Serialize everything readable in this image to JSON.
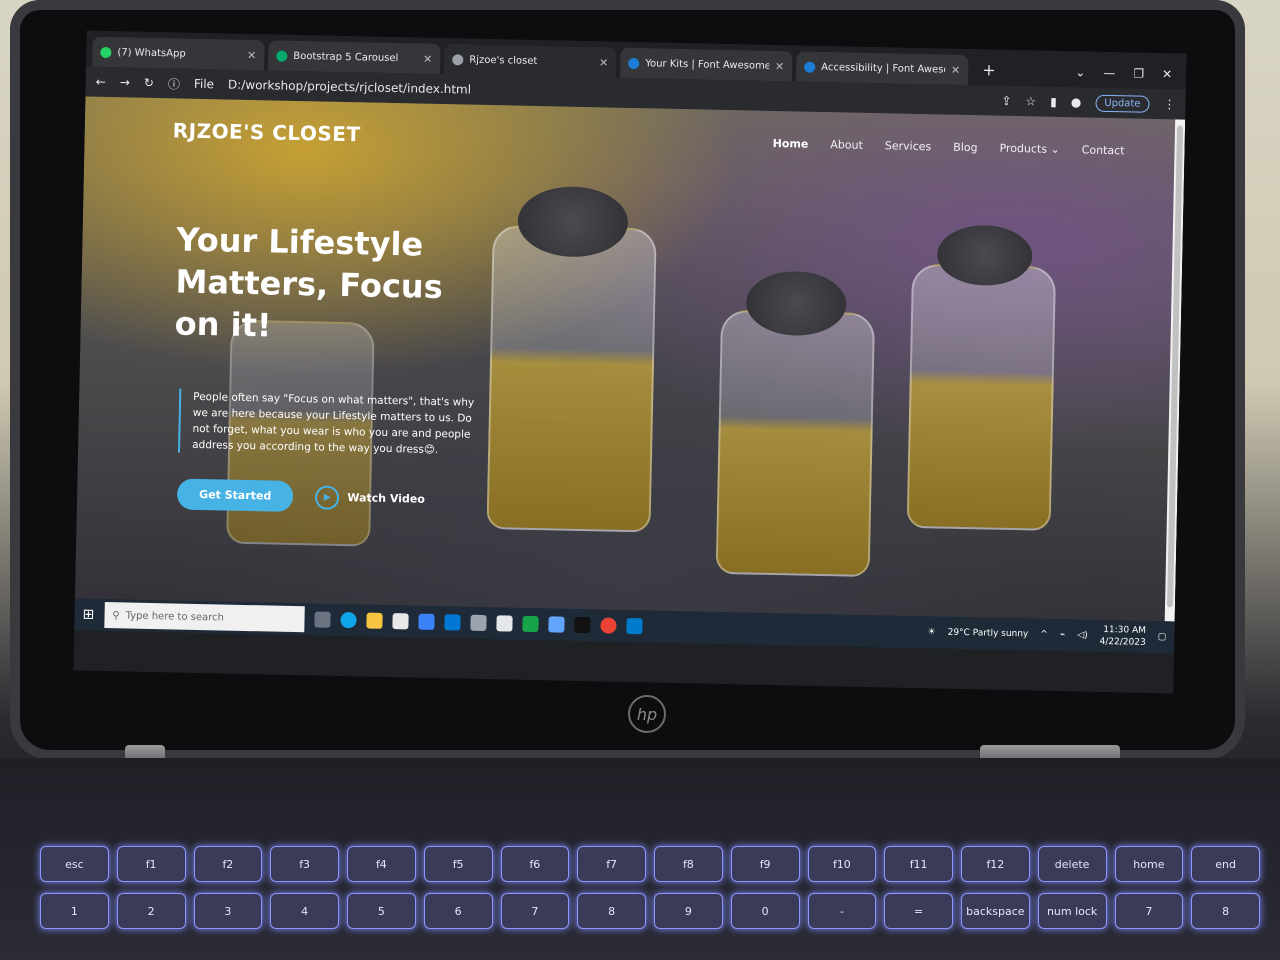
{
  "browser": {
    "tabs": [
      {
        "title": "(7) WhatsApp",
        "color": "#25d366"
      },
      {
        "title": "Bootstrap 5 Carousel",
        "color": "#04aa6d"
      },
      {
        "title": "Rjzoe's closet",
        "color": "#9aa0a6"
      },
      {
        "title": "Your Kits | Font Awesome",
        "color": "#1c7ed6"
      },
      {
        "title": "Accessibility | Font Awesome Do",
        "color": "#1c7ed6"
      }
    ],
    "address_prefix": "File",
    "url": "D:/workshop/projects/rjcloset/index.html",
    "update_label": "Update"
  },
  "site": {
    "brand": "RJZOE'S CLOSET",
    "menu": [
      "Home",
      "About",
      "Services",
      "Blog",
      "Products",
      "Contact"
    ],
    "hero_title": "Your Lifestyle Matters, Focus on it!",
    "hero_text": "People often say \"Focus on what matters\", that's why we are here because your Lifestyle matters to us. Do not forget, what you wear is who you are and people address you according to the way you dress😊.",
    "cta_primary": "Get Started",
    "cta_secondary": "Watch Video"
  },
  "taskbar": {
    "search_placeholder": "Type here to search",
    "weather": "29°C  Partly sunny",
    "time": "11:30 AM",
    "date": "4/22/2023"
  },
  "device": {
    "brand": "hp"
  }
}
